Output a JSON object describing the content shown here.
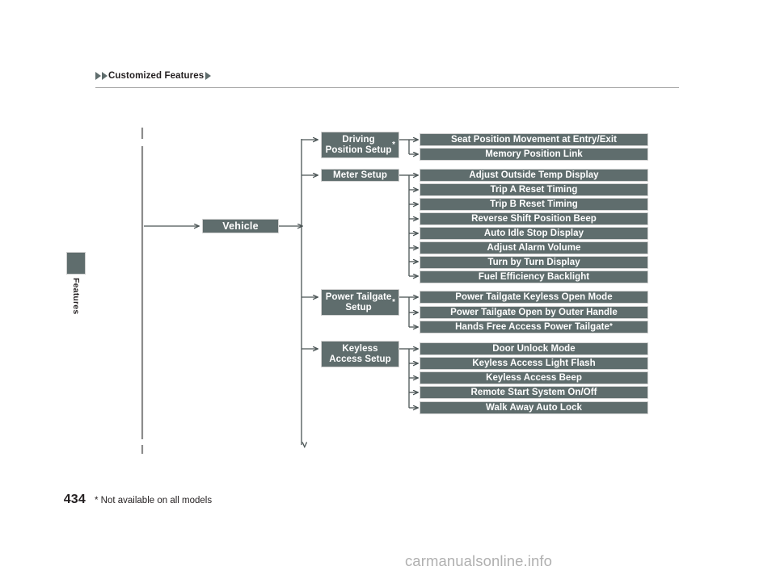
{
  "header": {
    "breadcrumb": "Customized Features",
    "leading_icon": "triangle-right-icon",
    "trailing_icon": "triangle-right-icon"
  },
  "side_tab": {
    "label": "Features"
  },
  "diagram": {
    "root": {
      "label": "Vehicle"
    },
    "groups": [
      {
        "category": "Driving Position Setup",
        "category_has_asterisk": true,
        "items": [
          {
            "label": "Seat Position Movement at Entry/Exit",
            "asterisk": false
          },
          {
            "label": "Memory Position Link",
            "asterisk": false
          }
        ]
      },
      {
        "category": "Meter Setup",
        "category_has_asterisk": false,
        "items": [
          {
            "label": "Adjust Outside Temp Display",
            "asterisk": false
          },
          {
            "label": "Trip A Reset Timing",
            "asterisk": false
          },
          {
            "label": "Trip B Reset Timing",
            "asterisk": false
          },
          {
            "label": "Reverse Shift Position Beep",
            "asterisk": false
          },
          {
            "label": "Auto Idle Stop Display",
            "asterisk": false
          },
          {
            "label": "Adjust Alarm Volume",
            "asterisk": false
          },
          {
            "label": "Turn by Turn Display",
            "asterisk": false
          },
          {
            "label": "Fuel Efficiency Backlight",
            "asterisk": false
          }
        ]
      },
      {
        "category": "Power Tailgate Setup",
        "category_has_asterisk": true,
        "items": [
          {
            "label": "Power Tailgate Keyless Open Mode",
            "asterisk": false
          },
          {
            "label": "Power Tailgate Open by Outer Handle",
            "asterisk": false
          },
          {
            "label": "Hands Free Access Power Tailgate",
            "asterisk": true
          }
        ]
      },
      {
        "category": "Keyless Access Setup",
        "category_has_asterisk": false,
        "items": [
          {
            "label": "Door Unlock Mode",
            "asterisk": false
          },
          {
            "label": "Keyless Access Light Flash",
            "asterisk": false
          },
          {
            "label": "Keyless Access Beep",
            "asterisk": false
          },
          {
            "label": "Remote Start System On/Off",
            "asterisk": false
          },
          {
            "label": "Walk Away Auto Lock",
            "asterisk": false
          }
        ]
      }
    ]
  },
  "footer": {
    "page_number": "434",
    "footnote": "* Not available on all models"
  },
  "watermark": {
    "text": "carmanualsonline.info"
  },
  "colors": {
    "node_fill": "#5f6d6d",
    "node_text": "#ffffff",
    "connector": "#4a5455",
    "rule": "#a8a8a8",
    "text": "#231f20",
    "watermark": "#b0b0b0"
  }
}
